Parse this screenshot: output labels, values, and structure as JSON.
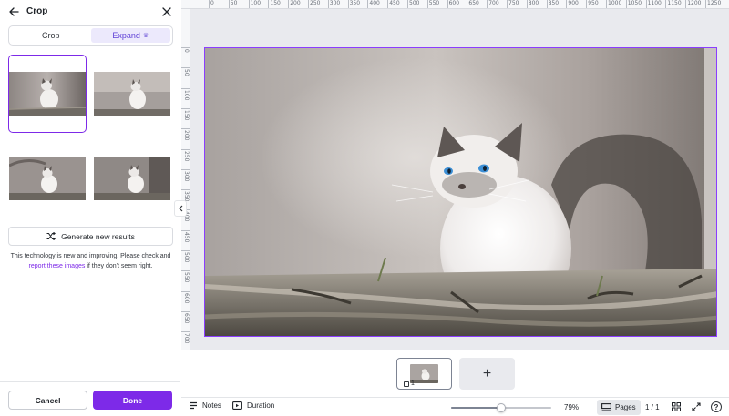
{
  "panel": {
    "title": "Crop",
    "tabs": [
      {
        "label": "Crop",
        "active": false
      },
      {
        "label": "Expand",
        "active": true,
        "badge": "crown-icon"
      }
    ],
    "results_selected_index": 0,
    "generate_button": "Generate new results",
    "disclaimer_before": "This technology is new and improving. Please check and",
    "disclaimer_link": "report these images",
    "disclaimer_after": "if they don't seem right.",
    "cancel_label": "Cancel",
    "done_label": "Done"
  },
  "ruler": {
    "top": [
      "0",
      "50",
      "100",
      "150",
      "200",
      "250",
      "300",
      "350",
      "400",
      "450",
      "500",
      "550",
      "600",
      "650",
      "700",
      "750",
      "800",
      "850",
      "900",
      "950",
      "1000",
      "1050",
      "1100",
      "1150",
      "1200",
      "1250"
    ],
    "left": [
      "0",
      "50",
      "100",
      "150",
      "200",
      "250",
      "300",
      "350",
      "400",
      "450",
      "500",
      "550",
      "600",
      "650",
      "700"
    ]
  },
  "pages": {
    "current_page_label": "1",
    "add_page_label": "+"
  },
  "bottombar": {
    "notes_label": "Notes",
    "duration_label": "Duration",
    "zoom_level": 0.5,
    "zoom_label": "79%",
    "pages_label": "Pages",
    "page_count": "1 / 1",
    "help_label": "?"
  },
  "colors": {
    "accent": "#7d2ae8",
    "selection_border": "#8b3dff",
    "tab_active_bg": "#ece9fc"
  }
}
